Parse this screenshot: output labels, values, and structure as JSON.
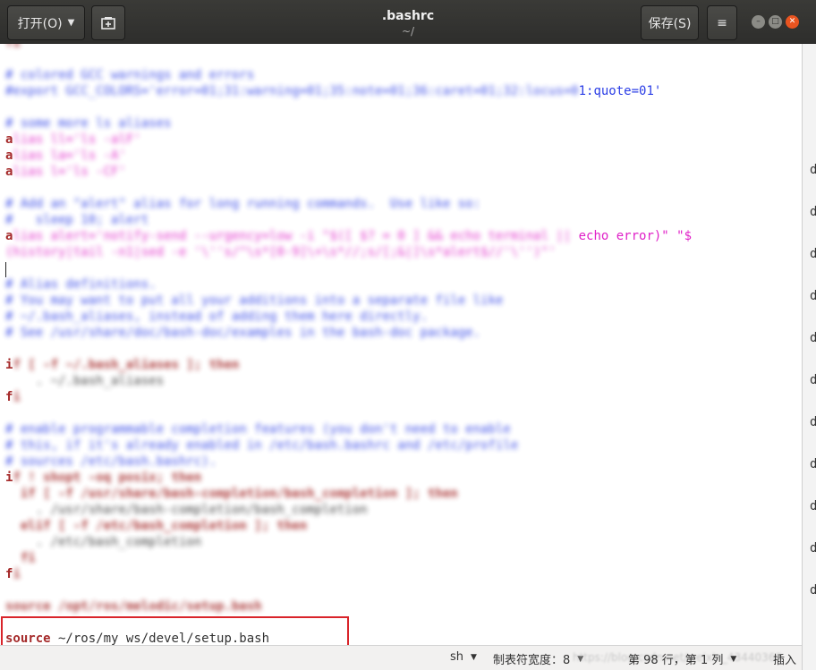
{
  "header": {
    "open_label": "打开(O)",
    "open_icon": "caret-down-icon",
    "new_tab_icon": "new-document-icon",
    "title": ".bashrc",
    "subtitle": "~/",
    "save_label": "保存(S)",
    "menu_icon": "hamburger-menu-icon",
    "window_controls": [
      "minimize",
      "maximize",
      "close"
    ]
  },
  "editor": {
    "lines": [
      {
        "segments": [
          {
            "t": "fi",
            "c": "kw",
            "blur": true
          }
        ]
      },
      {
        "segments": []
      },
      {
        "segments": [
          {
            "t": "# colored GCC warnings and errors",
            "c": "com",
            "blur": true
          }
        ]
      },
      {
        "segments": [
          {
            "t": "#export GCC_COLORS='error=01;31:warning=01;35:note=01;36:caret=01;32:locus=0",
            "c": "com",
            "blur": true
          },
          {
            "t": "1:quote=01'",
            "c": "com",
            "blur": false
          }
        ]
      },
      {
        "segments": []
      },
      {
        "segments": [
          {
            "t": "# some more ls aliases",
            "c": "com",
            "blur": true
          }
        ]
      },
      {
        "segments": [
          {
            "t": "a",
            "c": "kw",
            "blur": false
          },
          {
            "t": "lias ll='ls -alF'",
            "c": "str",
            "blur": true
          }
        ]
      },
      {
        "segments": [
          {
            "t": "a",
            "c": "kw",
            "blur": false
          },
          {
            "t": "lias la='ls -A'",
            "c": "str",
            "blur": true
          }
        ]
      },
      {
        "segments": [
          {
            "t": "a",
            "c": "kw",
            "blur": false
          },
          {
            "t": "lias l='ls -CF'",
            "c": "str",
            "blur": true
          }
        ]
      },
      {
        "segments": []
      },
      {
        "segments": [
          {
            "t": "# Add an \"alert\" alias for long running commands.  Use like so:",
            "c": "com",
            "blur": true
          }
        ]
      },
      {
        "segments": [
          {
            "t": "#   sleep 10; alert",
            "c": "com",
            "blur": true
          }
        ]
      },
      {
        "segments": [
          {
            "t": "a",
            "c": "kw",
            "blur": false
          },
          {
            "t": "lias alert='notify-send --urgency=low -i \"$([ $? = 0 ] && echo terminal || ",
            "c": "str",
            "blur": true
          },
          {
            "t": "echo error)\" \"$",
            "c": "str",
            "blur": false
          }
        ]
      },
      {
        "segments": [
          {
            "t": "(history|tail -n1|sed -e '\\''s/^\\s*[0-9]\\+\\s*//;s/[;&|]\\s*alert$//'\\'')\"'",
            "c": "str",
            "blur": true
          }
        ]
      },
      {
        "segments": []
      },
      {
        "segments": [
          {
            "t": "# Alias definitions.",
            "c": "com",
            "blur": true
          }
        ]
      },
      {
        "segments": [
          {
            "t": "# You may want to put all your additions into a separate file like",
            "c": "com",
            "blur": true
          }
        ]
      },
      {
        "segments": [
          {
            "t": "# ~/.bash_aliases, instead of adding them here directly.",
            "c": "com",
            "blur": true
          }
        ]
      },
      {
        "segments": [
          {
            "t": "# See /usr/share/doc/bash-doc/examples in the bash-doc package.",
            "c": "com",
            "blur": true
          }
        ]
      },
      {
        "segments": []
      },
      {
        "segments": [
          {
            "t": "i",
            "c": "kw",
            "blur": false
          },
          {
            "t": "f [ -f ~/.bash_aliases ]; then",
            "c": "kw",
            "blur": true
          }
        ]
      },
      {
        "segments": [
          {
            "t": "    . ~/.bash_aliases",
            "c": "plain",
            "blur": true
          }
        ]
      },
      {
        "segments": [
          {
            "t": "f",
            "c": "kw",
            "blur": false
          },
          {
            "t": "i",
            "c": "kw",
            "blur": true
          }
        ]
      },
      {
        "segments": []
      },
      {
        "segments": [
          {
            "t": "# enable programmable completion features (you don't need to enable",
            "c": "com",
            "blur": true
          }
        ]
      },
      {
        "segments": [
          {
            "t": "# this, if it's already enabled in /etc/bash.bashrc and /etc/profile",
            "c": "com",
            "blur": true
          }
        ]
      },
      {
        "segments": [
          {
            "t": "# sources /etc/bash.bashrc).",
            "c": "com",
            "blur": true
          }
        ]
      },
      {
        "segments": [
          {
            "t": "i",
            "c": "kw",
            "blur": false
          },
          {
            "t": "f ! shopt -oq posix; then",
            "c": "kw",
            "blur": true
          }
        ]
      },
      {
        "segments": [
          {
            "t": "  if [ -f /usr/share/bash-completion/bash_completion ]; then",
            "c": "kw",
            "blur": true
          }
        ]
      },
      {
        "segments": [
          {
            "t": "    . /usr/share/bash-completion/bash_completion",
            "c": "plain",
            "blur": true
          }
        ]
      },
      {
        "segments": [
          {
            "t": "  elif [ -f /etc/bash_completion ]; then",
            "c": "kw",
            "blur": true
          }
        ]
      },
      {
        "segments": [
          {
            "t": "    . /etc/bash_completion",
            "c": "plain",
            "blur": true
          }
        ]
      },
      {
        "segments": [
          {
            "t": "  fi",
            "c": "kw",
            "blur": true
          }
        ]
      },
      {
        "segments": [
          {
            "t": "f",
            "c": "kw",
            "blur": false
          },
          {
            "t": "i",
            "c": "kw",
            "blur": true
          }
        ]
      },
      {
        "segments": []
      },
      {
        "segments": [
          {
            "t": "source /opt/ros/melodic/setup.bash",
            "c": "kw",
            "blur": true
          }
        ]
      },
      {
        "segments": []
      },
      {
        "segments": [
          {
            "t": "source",
            "c": "kw",
            "blur": false
          },
          {
            "t": " ~/ros/my_ws/devel/setup.bash",
            "c": "plain",
            "blur": false
          }
        ]
      }
    ]
  },
  "right_strip": [
    "d",
    "d",
    "d",
    "d",
    "d",
    "d",
    "d",
    "d",
    "d",
    "d",
    "d"
  ],
  "status": {
    "language": "sh",
    "tab_width": "制表符宽度：8",
    "position": "第 98 行，第 1 列",
    "mode": "插入",
    "watermark": "https://blog.csdn.net/weixin_43440368"
  }
}
